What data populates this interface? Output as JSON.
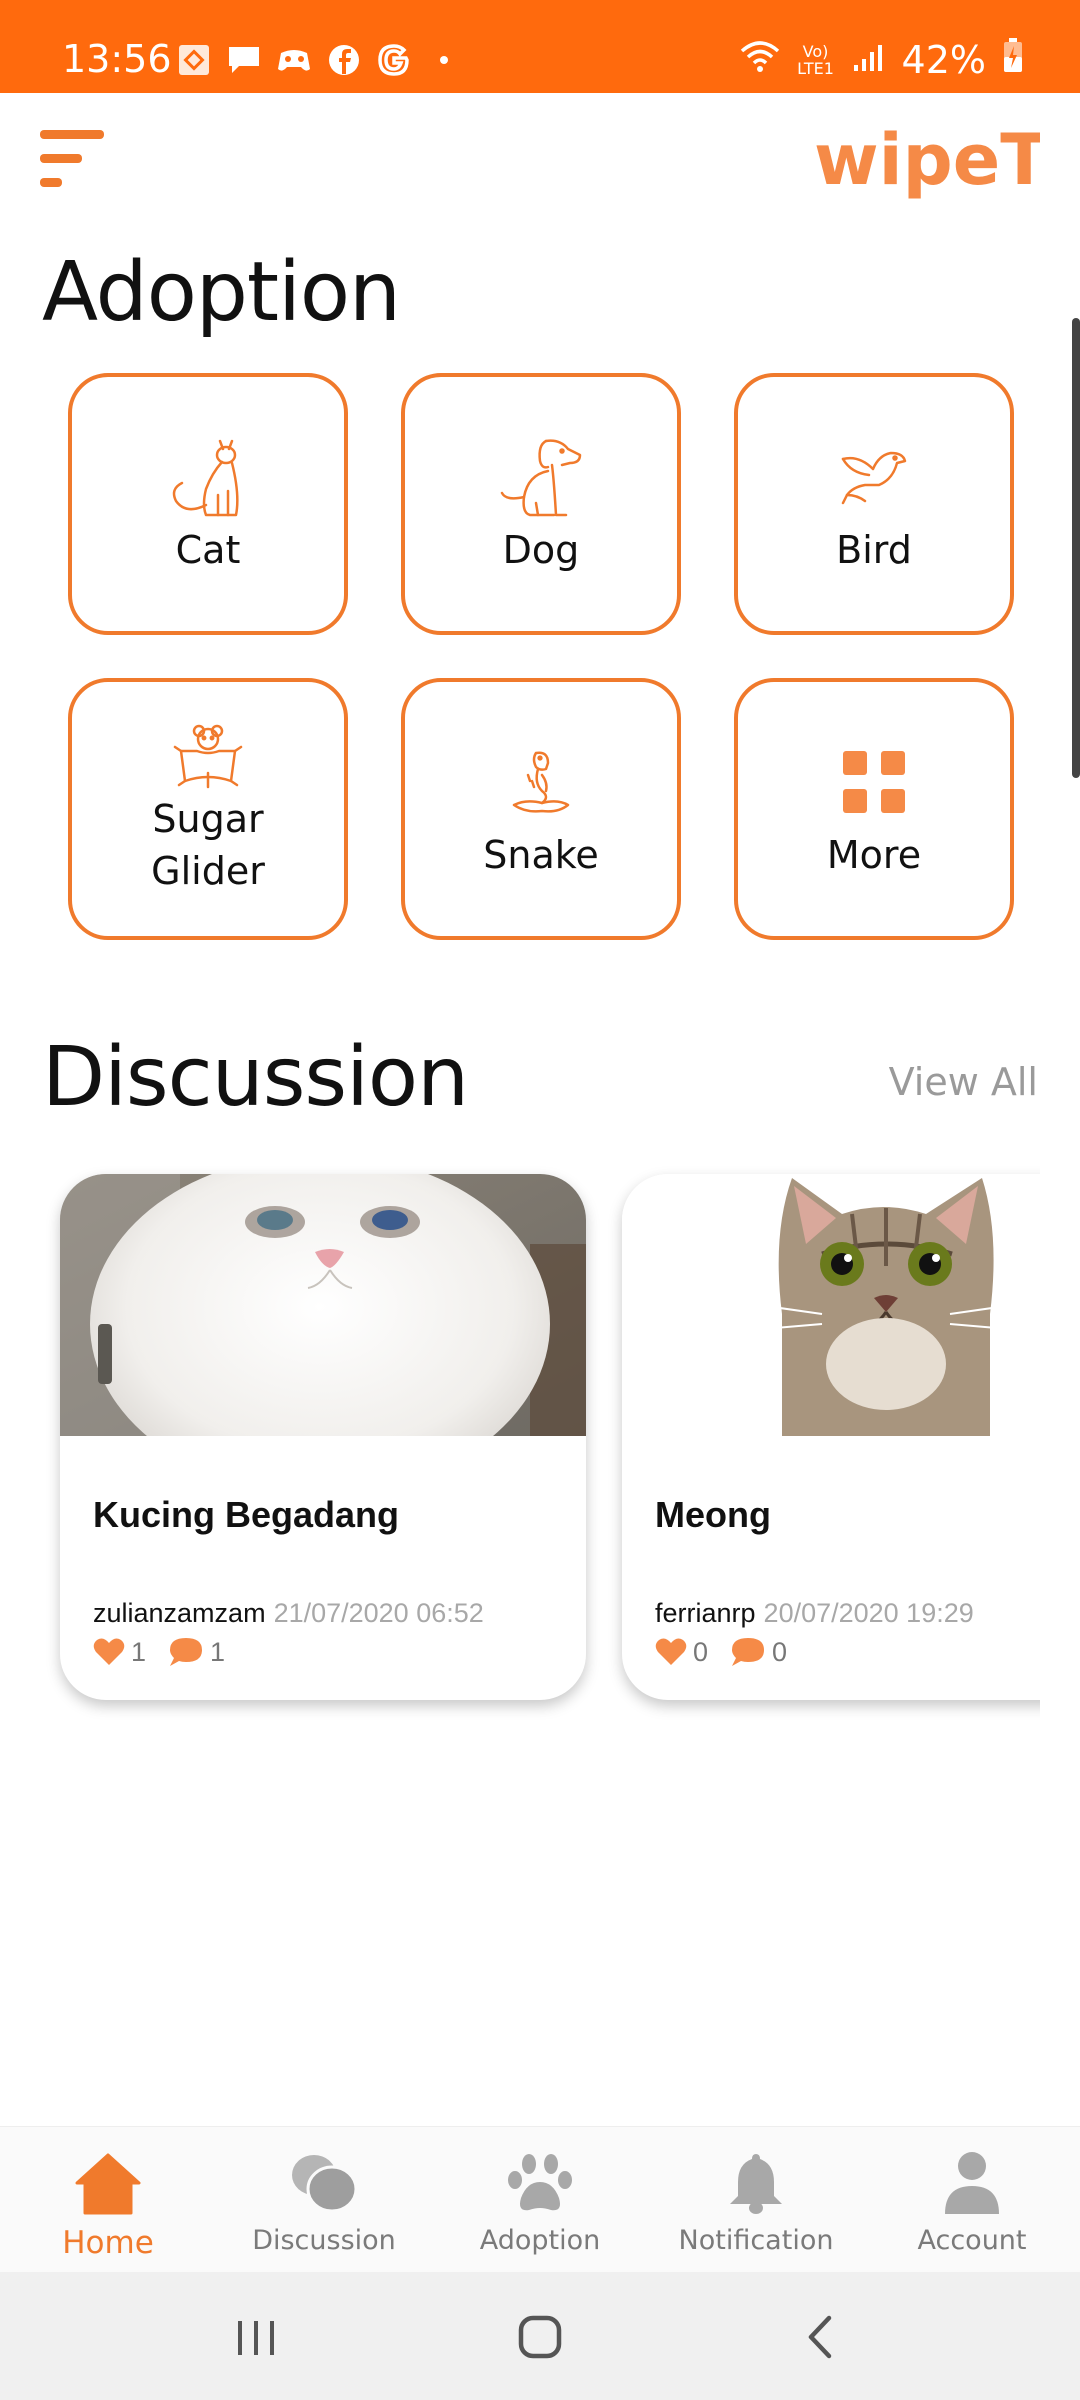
{
  "status_bar": {
    "time": "13:56",
    "battery": "42%",
    "network": "Vo) LTE1",
    "left_icons": [
      "app-notification-icon",
      "message-icon",
      "game-icon",
      "facebook-icon",
      "google-icon",
      "dot-icon"
    ],
    "right_icons": [
      "wifi-icon",
      "signal-icon",
      "battery-icon"
    ]
  },
  "header": {
    "logo_text": "wipeT",
    "menu_icon": "menu-icon"
  },
  "adoption": {
    "title": "Adoption",
    "categories": [
      {
        "label": "Cat",
        "icon": "cat-icon"
      },
      {
        "label": "Dog",
        "icon": "dog-icon"
      },
      {
        "label": "Bird",
        "icon": "bird-icon"
      },
      {
        "label": "Sugar Glider",
        "icon": "sugar-glider-icon"
      },
      {
        "label": "Snake",
        "icon": "snake-icon"
      },
      {
        "label": "More",
        "icon": "grid-icon"
      }
    ]
  },
  "discussion": {
    "title": "Discussion",
    "view_all": "View All",
    "posts": [
      {
        "title": "Kucing Begadang",
        "author": "zulianzamzam",
        "date": "21/07/2020 06:52",
        "likes": "1",
        "comments": "1"
      },
      {
        "title": "Meong",
        "author": "ferrianrp",
        "date": "20/07/2020 19:29",
        "likes": "0",
        "comments": "0"
      }
    ]
  },
  "bottom_nav": {
    "items": [
      {
        "label": "Home",
        "icon": "home-icon",
        "active": true
      },
      {
        "label": "Discussion",
        "icon": "chat-bubbles-icon",
        "active": false
      },
      {
        "label": "Adoption",
        "icon": "paw-icon",
        "active": false
      },
      {
        "label": "Notification",
        "icon": "bell-icon",
        "active": false
      },
      {
        "label": "Account",
        "icon": "person-icon",
        "active": false
      }
    ]
  },
  "colors": {
    "accent": "#f07a2c",
    "status_bar": "#ff6a0d",
    "inactive": "#9a9a9a"
  }
}
